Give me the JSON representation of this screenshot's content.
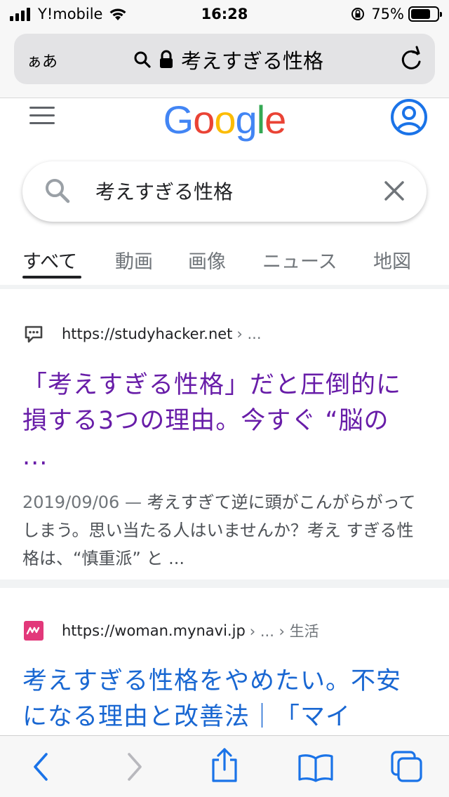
{
  "status_bar": {
    "carrier": "Y!mobile",
    "time": "16:28",
    "battery_percent": "75%",
    "battery_level": 0.75
  },
  "safari": {
    "aa_label": "ぁあ",
    "url_text": "考えすぎる性格"
  },
  "google": {
    "logo_letters": [
      {
        "ch": "G",
        "color": "#4285F4"
      },
      {
        "ch": "o",
        "color": "#EA4335"
      },
      {
        "ch": "o",
        "color": "#FBBC05"
      },
      {
        "ch": "g",
        "color": "#4285F4"
      },
      {
        "ch": "l",
        "color": "#34A853"
      },
      {
        "ch": "e",
        "color": "#EA4335"
      }
    ],
    "search_query": "考えすぎる性格",
    "tabs": [
      "すべて",
      "動画",
      "画像",
      "ニュース",
      "地図"
    ],
    "active_tab": "すべて"
  },
  "results": [
    {
      "site_url": "https://studyhacker.net",
      "site_path": "› ...",
      "title": "「考えすぎる性格」だと圧倒的に損する3つの理由。今すぐ “脳の ...",
      "date": "2019/09/06 — ",
      "snippet": "考えすぎて逆に頭がこんがらがってしまう。思い当たる人はいませんか？考え すぎる性格は、“慎重派” と ..."
    },
    {
      "site_url": "https://woman.mynavi.jp",
      "site_path": "› ... › 生活",
      "title": "考えすぎる性格をやめたい。不安になる理由と改善法｜「マイ"
    }
  ],
  "colors": {
    "visited_link": "#681da8",
    "link": "#1967d2",
    "ios_blue": "#1a73e8"
  }
}
